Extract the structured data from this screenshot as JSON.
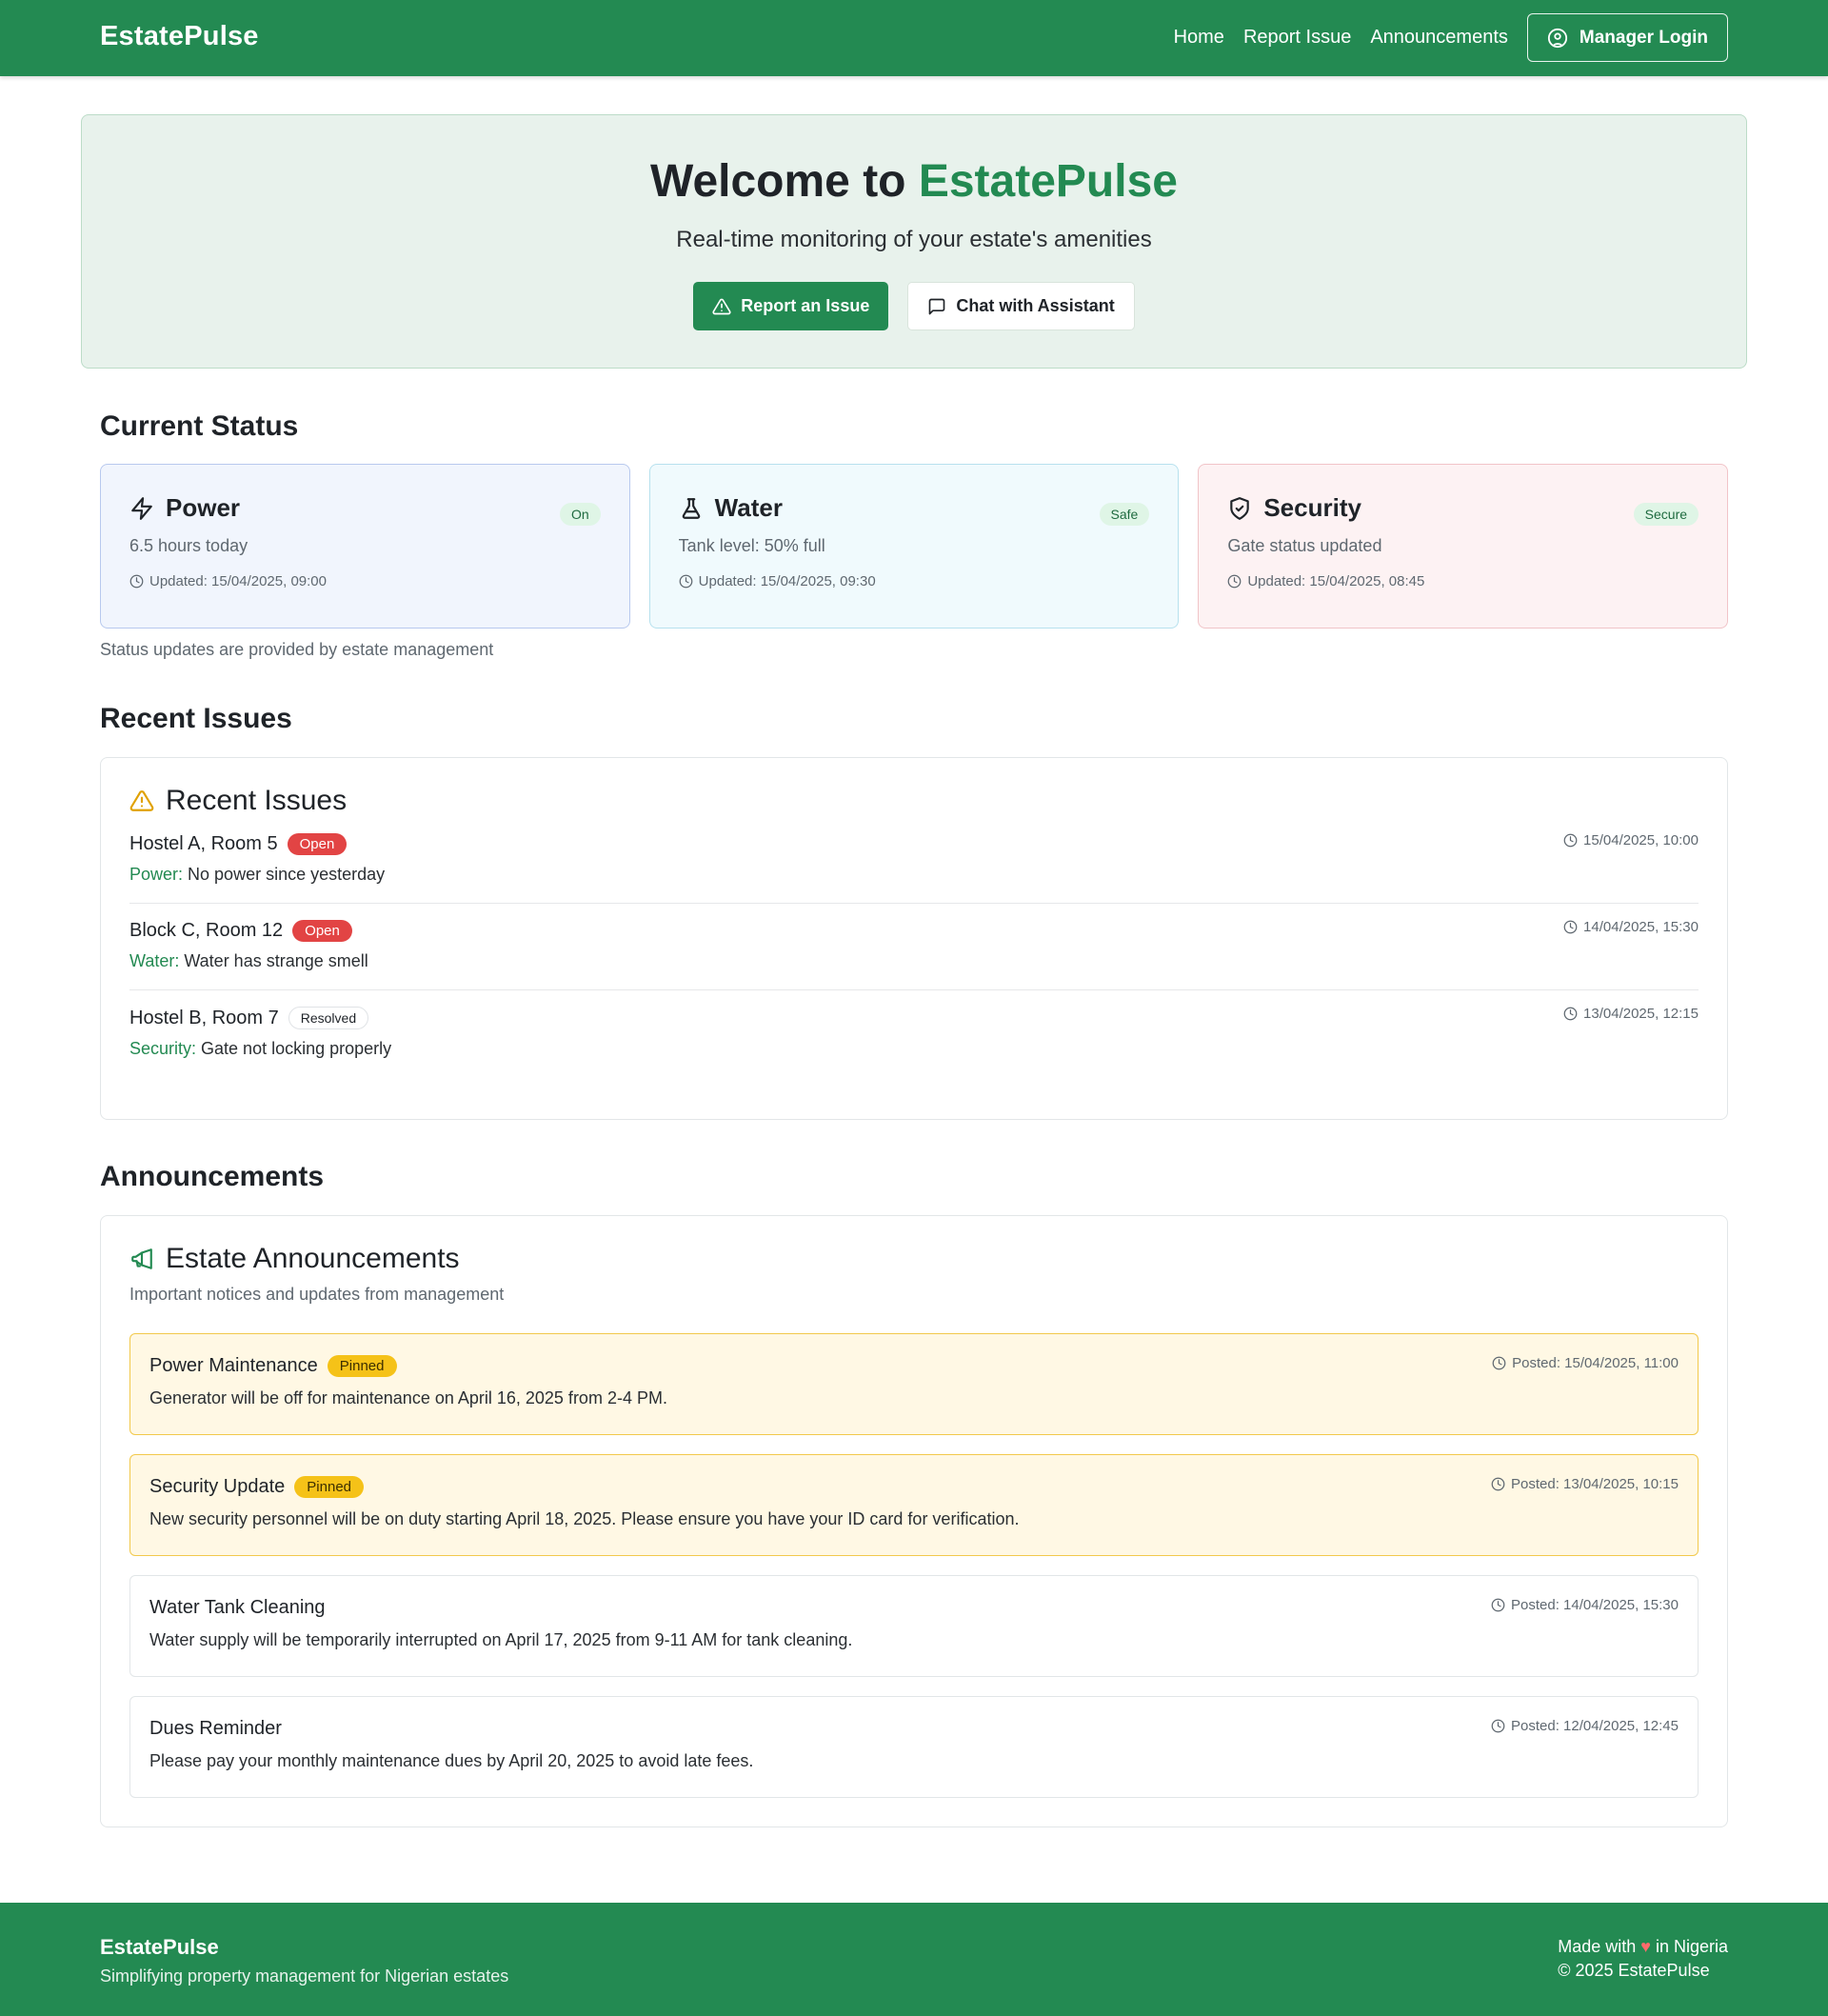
{
  "nav": {
    "brand": "EstatePulse",
    "links": [
      "Home",
      "Report Issue",
      "Announcements"
    ],
    "login_label": "Manager Login"
  },
  "hero": {
    "title_prefix": "Welcome to ",
    "title_accent": "EstatePulse",
    "subtitle": "Real-time monitoring of your estate's amenities",
    "report_label": "Report an Issue",
    "chat_label": "Chat with Assistant"
  },
  "status": {
    "heading": "Current Status",
    "cards": [
      {
        "title": "Power",
        "badge": "On",
        "detail": "6.5 hours today",
        "updated": "Updated: 15/04/2025, 09:00"
      },
      {
        "title": "Water",
        "badge": "Safe",
        "detail": "Tank level: 50% full",
        "updated": "Updated: 15/04/2025, 09:30"
      },
      {
        "title": "Security",
        "badge": "Secure",
        "detail": "Gate status updated",
        "updated": "Updated: 15/04/2025, 08:45"
      }
    ],
    "note": "Status updates are provided by estate management"
  },
  "issues": {
    "heading": "Recent Issues",
    "panel_title": "Recent Issues",
    "items": [
      {
        "location": "Hostel A, Room 5",
        "status": "Open",
        "category": "Power:",
        "description": " No power since yesterday",
        "time": "15/04/2025, 10:00"
      },
      {
        "location": "Block C, Room 12",
        "status": "Open",
        "category": "Water:",
        "description": " Water has strange smell",
        "time": "14/04/2025, 15:30"
      },
      {
        "location": "Hostel B, Room 7",
        "status": "Resolved",
        "category": "Security:",
        "description": " Gate not locking properly",
        "time": "13/04/2025, 12:15"
      }
    ]
  },
  "announcements": {
    "heading": "Announcements",
    "panel_title": "Estate Announcements",
    "panel_subtitle": "Important notices and updates from management",
    "items": [
      {
        "title": "Power Maintenance",
        "pinned": "Pinned",
        "body": "Generator will be off for maintenance on April 16, 2025 from 2-4 PM.",
        "posted": "Posted: 15/04/2025, 11:00"
      },
      {
        "title": "Security Update",
        "pinned": "Pinned",
        "body": "New security personnel will be on duty starting April 18, 2025. Please ensure you have your ID card for verification.",
        "posted": "Posted: 13/04/2025, 10:15"
      },
      {
        "title": "Water Tank Cleaning",
        "pinned": "",
        "body": "Water supply will be temporarily interrupted on April 17, 2025 from 9-11 AM for tank cleaning.",
        "posted": "Posted: 14/04/2025, 15:30"
      },
      {
        "title": "Dues Reminder",
        "pinned": "",
        "body": "Please pay your monthly maintenance dues by April 20, 2025 to avoid late fees.",
        "posted": "Posted: 12/04/2025, 12:45"
      }
    ]
  },
  "footer": {
    "brand": "EstatePulse",
    "tagline": "Simplifying property management for Nigerian estates",
    "made_prefix": "Made with ",
    "heart": "♥",
    "made_suffix": " in Nigeria",
    "copyright": "© 2025 EstatePulse"
  },
  "colors": {
    "brand_green": "#238a52",
    "open_red": "#e24444",
    "pinned_yellow": "#f5c218"
  }
}
